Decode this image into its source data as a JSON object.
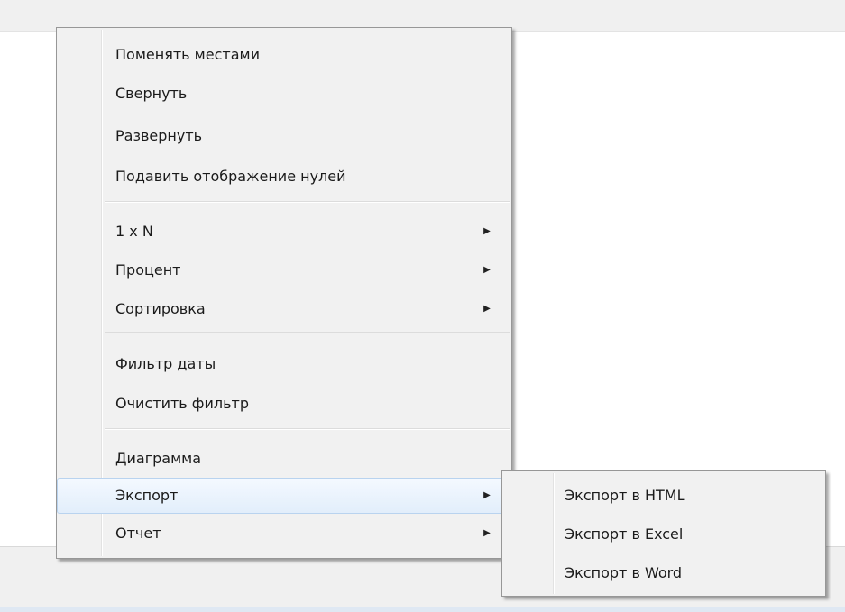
{
  "context_menu": {
    "items": [
      {
        "label": "Поменять местами",
        "submenu": false
      },
      {
        "label": "Свернуть",
        "submenu": false
      },
      {
        "label": "Развернуть",
        "submenu": false
      },
      {
        "label": "Подавить отображение нулей",
        "submenu": false
      },
      {
        "label": "1 x N",
        "submenu": true
      },
      {
        "label": "Процент",
        "submenu": true
      },
      {
        "label": "Сортировка",
        "submenu": true
      },
      {
        "label": "Фильтр даты",
        "submenu": false
      },
      {
        "label": "Очистить фильтр",
        "submenu": false
      },
      {
        "label": "Диаграмма",
        "submenu": false
      },
      {
        "label": "Экспорт",
        "submenu": true,
        "highlighted": true
      },
      {
        "label": "Отчет",
        "submenu": true
      }
    ],
    "arrow_glyph": "▶"
  },
  "export_submenu": {
    "items": [
      {
        "label": "Экспорт в HTML"
      },
      {
        "label": "Экспорт в Excel"
      },
      {
        "label": "Экспорт в Word"
      }
    ]
  },
  "colors": {
    "menu_background": "#f1f1f1",
    "highlight_border": "#b9d3ef",
    "highlight_fill": "#e2eefb"
  }
}
